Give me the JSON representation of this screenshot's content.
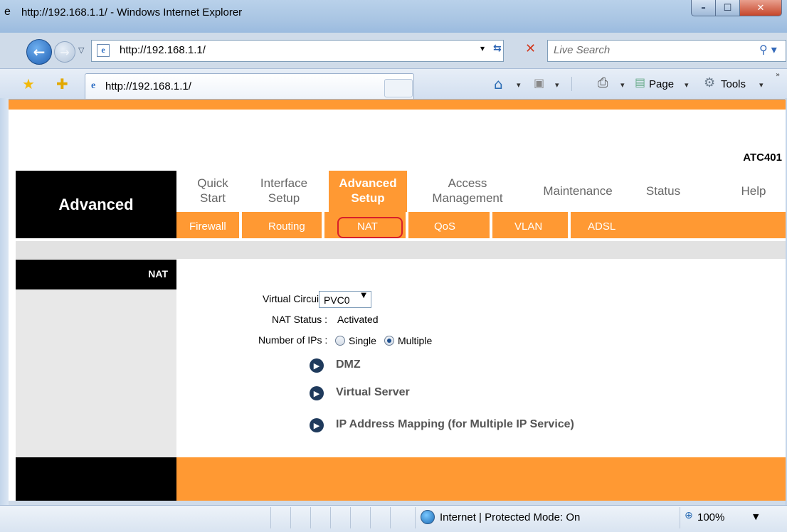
{
  "window": {
    "title": "http://192.168.1.1/ - Windows Internet Explorer"
  },
  "address_bar": {
    "url": "http://192.168.1.1/"
  },
  "search": {
    "placeholder": "Live Search"
  },
  "tab": {
    "label": "http://192.168.1.1/"
  },
  "command_bar": {
    "page_label": "Page",
    "tools_label": "Tools"
  },
  "router": {
    "model": "ATC401",
    "section_title": "Advanced",
    "top_nav": [
      {
        "line1": "Quick",
        "line2": "Start"
      },
      {
        "line1": "Interface",
        "line2": "Setup"
      },
      {
        "line1": "Advanced",
        "line2": "Setup",
        "active": true
      },
      {
        "line1": "Access",
        "line2": "Management"
      },
      {
        "line1": "Maintenance",
        "line2": ""
      },
      {
        "line1": "Status",
        "line2": ""
      },
      {
        "line1": "Help",
        "line2": ""
      }
    ],
    "sub_nav": [
      "Firewall",
      "Routing",
      "NAT",
      "QoS",
      "VLAN",
      "ADSL"
    ],
    "active_sub": "NAT",
    "sidebar_label": "NAT",
    "form": {
      "virtual_circuit_label": "Virtual Circuit :",
      "virtual_circuit_value": "PVC0",
      "nat_status_label": "NAT Status :",
      "nat_status_value": "Activated",
      "num_ips_label": "Number of IPs :",
      "option_single": "Single",
      "option_multiple": "Multiple",
      "selected_option": "Multiple"
    },
    "links": [
      "DMZ",
      "Virtual Server",
      "IP Address Mapping (for Multiple IP Service)"
    ]
  },
  "status_bar": {
    "zone": "Internet | Protected Mode: On",
    "zoom": "100%"
  },
  "colors": {
    "orange": "#ff9933",
    "black": "#000000",
    "highlight": "#d81f2a"
  }
}
